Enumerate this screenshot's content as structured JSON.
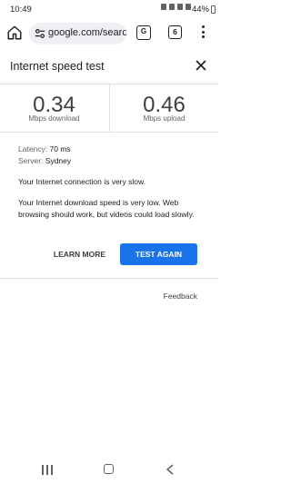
{
  "status_bar": {
    "time": "10:49",
    "battery": "44%"
  },
  "browser": {
    "url": "google.com/searc",
    "translate_label": "G",
    "tab_count": "6"
  },
  "panel": {
    "title": "Internet speed test",
    "download": {
      "value": "0.34",
      "unit": "Mbps download"
    },
    "upload": {
      "value": "0.46",
      "unit": "Mbps upload"
    },
    "latency_label": "Latency:",
    "latency_value": "70 ms",
    "server_label": "Server:",
    "server_value": "Sydney",
    "message_1": "Your Internet connection is very slow.",
    "message_2": "Your Internet download speed is very low. Web browsing should work, but videos could load slowly.",
    "learn_more": "LEARN MORE",
    "test_again": "TEST AGAIN",
    "feedback": "Feedback"
  },
  "colors": {
    "accent": "#1a73e8",
    "omnibox_bg": "#eef0f3",
    "divider": "#e0e0e0"
  }
}
